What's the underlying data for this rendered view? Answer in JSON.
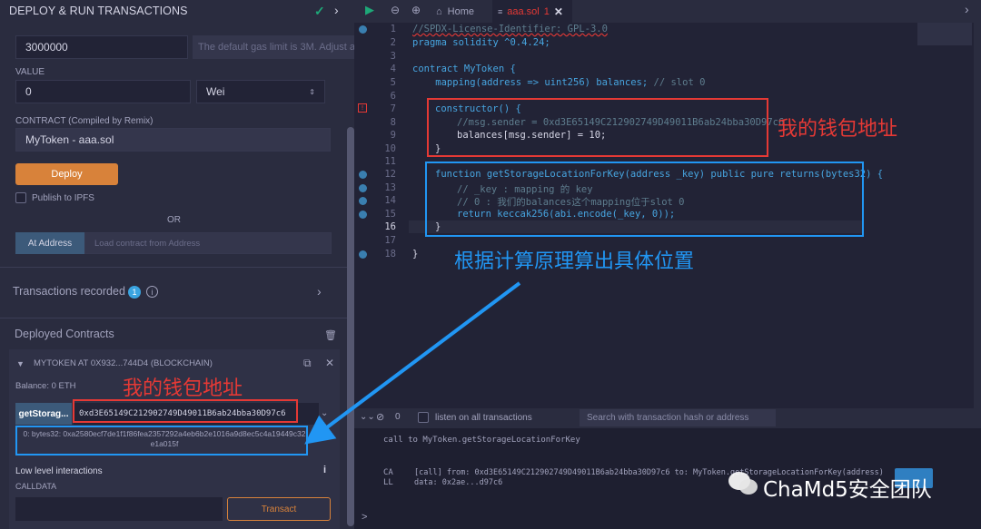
{
  "left": {
    "title": "DEPLOY & RUN TRANSACTIONS",
    "gas_limit_value": "3000000",
    "gas_hint": "The default gas limit is 3M. Adjust as needed.",
    "value_label": "VALUE",
    "value_amount": "0",
    "value_unit": "Wei",
    "contract_label": "CONTRACT (Compiled by Remix)",
    "contract_selected": "MyToken - aaa.sol",
    "deploy_label": "Deploy",
    "publish_label": "Publish to IPFS",
    "or_label": "OR",
    "at_address_label": "At Address",
    "load_contract_placeholder": "Load contract from Address",
    "transactions_recorded_label": "Transactions recorded",
    "transactions_recorded_count": "1",
    "deployed_contracts_label": "Deployed Contracts",
    "instance_title": "MYTOKEN AT 0X932...744D4 (BLOCKCHAIN)",
    "balance": "Balance: 0 ETH",
    "fn_button_label": "getStorag...",
    "fn_input_value": "0xd3E65149C212902749D49011B6ab24bba30D97c6",
    "fn_result": "0: bytes32: 0xa2580ecf7de1f1f86fea2357292a4eb6b2e1016a9d8ec5c4a19449c32e1a015f",
    "low_level_label": "Low level interactions",
    "calldata_label": "CALLDATA",
    "transact_label": "Transact"
  },
  "tabs": {
    "home_label": "Home",
    "file_label": "aaa.sol",
    "file_badge": "1"
  },
  "code": {
    "lines": [
      "1",
      "2",
      "3",
      "4",
      "5",
      "6",
      "7",
      "8",
      "9",
      "10",
      "11",
      "12",
      "13",
      "14",
      "15",
      "16",
      "17",
      "18"
    ],
    "l1": "//SPDX-License-Identifier: GPL-3.0",
    "l2": "pragma solidity ^0.4.24;",
    "l4": "contract MyToken {",
    "l5a": "    mapping(address => uint256) balances; ",
    "l5b": "// slot 0",
    "l7": "constructor() {",
    "l8": "//msg.sender = 0xd3E65149C212902749D49011B6ab24bba30D97c6",
    "l9": "balances[msg.sender] = 10;",
    "l10": "}",
    "l12": "function getStorageLocationForKey(address _key) public pure returns(bytes32) {",
    "l13": "// _key : mapping 的 key",
    "l14": "// 0 : 我们的balances这个mapping位于slot 0",
    "l15": "return keccak256(abi.encode(_key, 0));",
    "l16": "}",
    "l18": "}"
  },
  "terminal": {
    "count": "0",
    "listen_label": "listen on all transactions",
    "search_placeholder": "Search with transaction hash or address",
    "line_top": "call to MyToken.getStorageLocationForKey",
    "call_tag": "CALL",
    "call_line1": "[call]  from: 0xd3E65149C212902749D49011B6ab24bba30D97c6 to: MyToken.getStorageLocationForKey(address)",
    "call_line2": "data: 0x2ae...d97c6",
    "prompt": ">"
  },
  "annotations": {
    "wallet_1": "我的钱包地址",
    "calc": "根据计算原理算出具体位置",
    "wallet_2": "我的钱包地址",
    "watermark": "ChaMd5安全团队"
  },
  "colors": {
    "accent_orange": "#d8823a",
    "red_box": "#e53935",
    "blue_box": "#2196f3",
    "check_green": "#1ea878"
  }
}
